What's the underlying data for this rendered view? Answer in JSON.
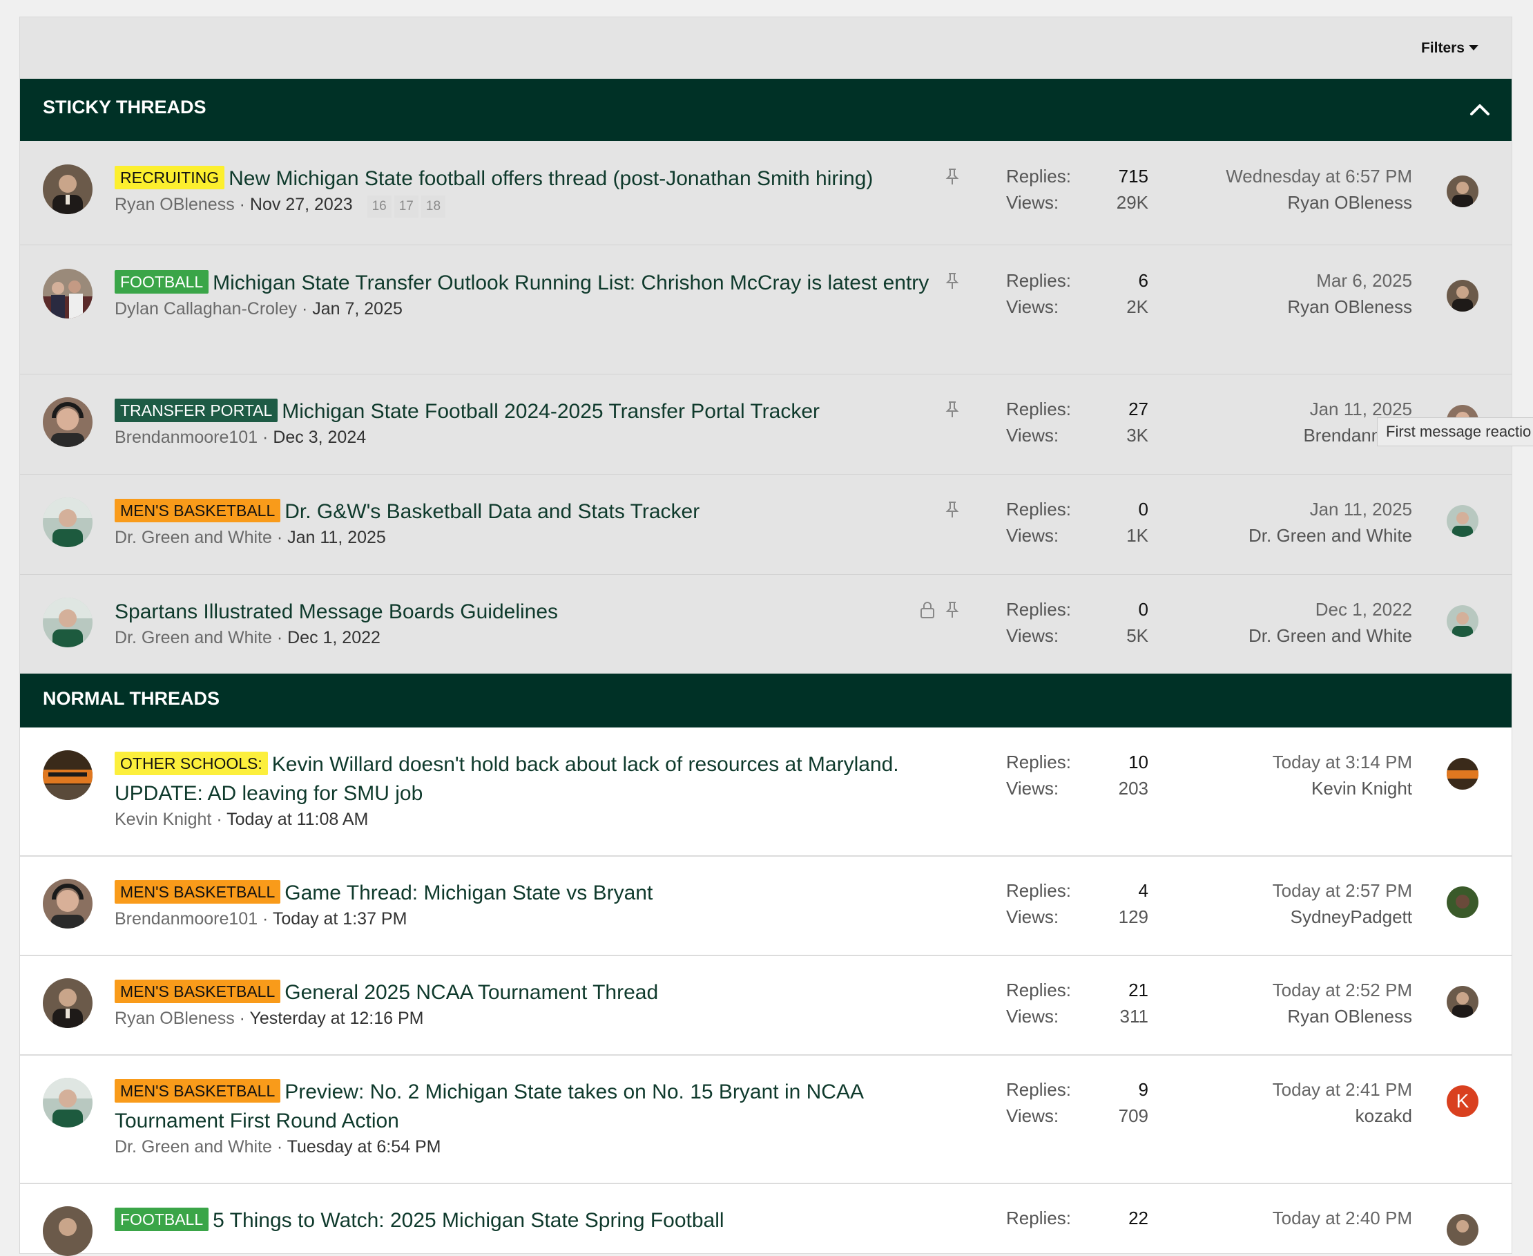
{
  "filter_bar": {
    "filters_label": "Filters"
  },
  "sticky": {
    "heading": "STICKY THREADS",
    "rows": [
      {
        "label": "RECRUITING",
        "title": "New Michigan State football offers thread (post-Jonathan Smith hiring)",
        "author": "Ryan OBleness",
        "date": "Nov 27, 2023",
        "pages": [
          "16",
          "17",
          "18"
        ],
        "replies_label": "Replies:",
        "replies": "715",
        "views_label": "Views:",
        "views": "29K",
        "last_date": "Wednesday at 6:57 PM",
        "last_user": "Ryan OBleness"
      },
      {
        "label": "FOOTBALL",
        "title": "Michigan State Transfer Outlook Running List: Chrishon McCray is latest entry",
        "author": "Dylan Callaghan-Croley",
        "date": "Jan 7, 2025",
        "replies_label": "Replies:",
        "replies": "6",
        "views_label": "Views:",
        "views": "2K",
        "last_date": "Mar 6, 2025",
        "last_user": "Ryan OBleness"
      },
      {
        "label": "TRANSFER PORTAL",
        "title": "Michigan State Football 2024-2025 Transfer Portal Tracker",
        "author": "Brendanmoore101",
        "date": "Dec 3, 2024",
        "replies_label": "Replies:",
        "replies": "27",
        "views_label": "Views:",
        "views": "3K",
        "last_date": "Jan 11, 2025",
        "last_user": "Brendanmoor"
      },
      {
        "label": "MEN'S BASKETBALL",
        "title": "Dr. G&W's Basketball Data and Stats Tracker",
        "author": "Dr. Green and White",
        "date": "Jan 11, 2025",
        "replies_label": "Replies:",
        "replies": "0",
        "views_label": "Views:",
        "views": "1K",
        "last_date": "Jan 11, 2025",
        "last_user": "Dr. Green and White"
      },
      {
        "label": "",
        "title": "Spartans Illustrated Message Boards Guidelines",
        "author": "Dr. Green and White",
        "date": "Dec 1, 2022",
        "replies_label": "Replies:",
        "replies": "0",
        "views_label": "Views:",
        "views": "5K",
        "last_date": "Dec 1, 2022",
        "last_user": "Dr. Green and White"
      }
    ],
    "tooltip": "First message reactio"
  },
  "normal": {
    "heading": "NORMAL THREADS",
    "rows": [
      {
        "label": "OTHER SCHOOLS:",
        "title": "Kevin Willard doesn't hold back about lack of resources at Maryland. UPDATE: AD leaving for SMU job",
        "author": "Kevin Knight",
        "date": "Today at 11:08 AM",
        "replies_label": "Replies:",
        "replies": "10",
        "views_label": "Views:",
        "views": "203",
        "last_date": "Today at 3:14 PM",
        "last_user": "Kevin Knight"
      },
      {
        "label": "MEN'S BASKETBALL",
        "title": "Game Thread: Michigan State vs Bryant",
        "author": "Brendanmoore101",
        "date": "Today at 1:37 PM",
        "replies_label": "Replies:",
        "replies": "4",
        "views_label": "Views:",
        "views": "129",
        "last_date": "Today at 2:57 PM",
        "last_user": "SydneyPadgett"
      },
      {
        "label": "MEN'S BASKETBALL",
        "title": "General 2025 NCAA Tournament Thread",
        "author": "Ryan OBleness",
        "date": "Yesterday at 12:16 PM",
        "replies_label": "Replies:",
        "replies": "21",
        "views_label": "Views:",
        "views": "311",
        "last_date": "Today at 2:52 PM",
        "last_user": "Ryan OBleness"
      },
      {
        "label": "MEN'S BASKETBALL",
        "title": "Preview: No. 2 Michigan State takes on No. 15 Bryant in NCAA Tournament First Round Action",
        "author": "Dr. Green and White",
        "date": "Tuesday at 6:54 PM",
        "replies_label": "Replies:",
        "replies": "9",
        "views_label": "Views:",
        "views": "709",
        "last_date": "Today at 2:41 PM",
        "last_user": "kozakd",
        "last_avatar_letter": "K"
      },
      {
        "label": "FOOTBALL",
        "title": "5 Things to Watch: 2025 Michigan State Spring Football",
        "replies_label": "Replies:",
        "replies": "22",
        "last_date": "Today at 2:40 PM"
      }
    ]
  },
  "colors": {
    "header_green": "#003126",
    "recruiting": "#fcef2e",
    "football": "#3aa548",
    "transfer_portal": "#1e5b45",
    "mens_basketball": "#f99b1a",
    "other_schools": "#fcef3c",
    "avatar_k": "#d9401f"
  },
  "icons": [
    "chevron-up-icon",
    "thumbtack-icon",
    "lock-icon",
    "caret-down-icon"
  ]
}
